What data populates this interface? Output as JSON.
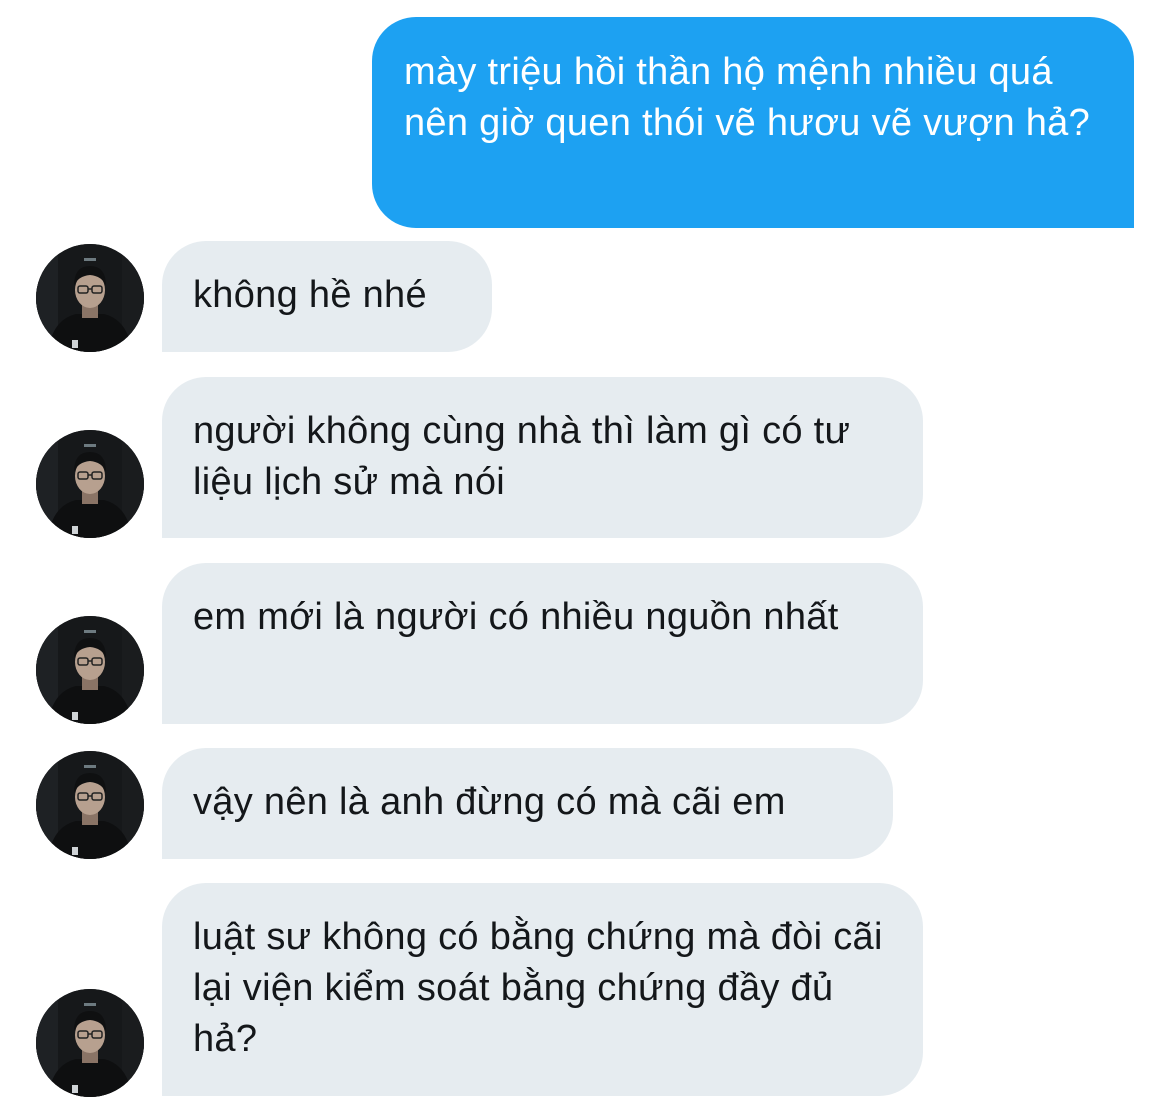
{
  "conversation": {
    "sent": [
      {
        "text": "mày triệu hồi thần hộ mệnh nhiều quá nên giờ quen thói vẽ hươu vẽ vượn hả?"
      }
    ],
    "received": [
      {
        "text": "không hề nhé",
        "avatar": "profile-photo"
      },
      {
        "text": "người không cùng nhà thì làm gì có tư liệu lịch sử mà nói",
        "avatar": "profile-photo"
      },
      {
        "text": "em mới là người có nhiều nguồn nhất",
        "avatar": "profile-photo"
      },
      {
        "text": "vậy nên là anh đừng có mà cãi em",
        "avatar": "profile-photo"
      },
      {
        "text": "luật sư không có bằng chứng mà đòi cãi lại viện kiểm soát bằng chứng đầy đủ hả?",
        "avatar": "profile-photo"
      }
    ]
  },
  "colors": {
    "sent_bubble": "#1da1f2",
    "received_bubble": "#e6ecf0",
    "received_text": "#14171a"
  }
}
